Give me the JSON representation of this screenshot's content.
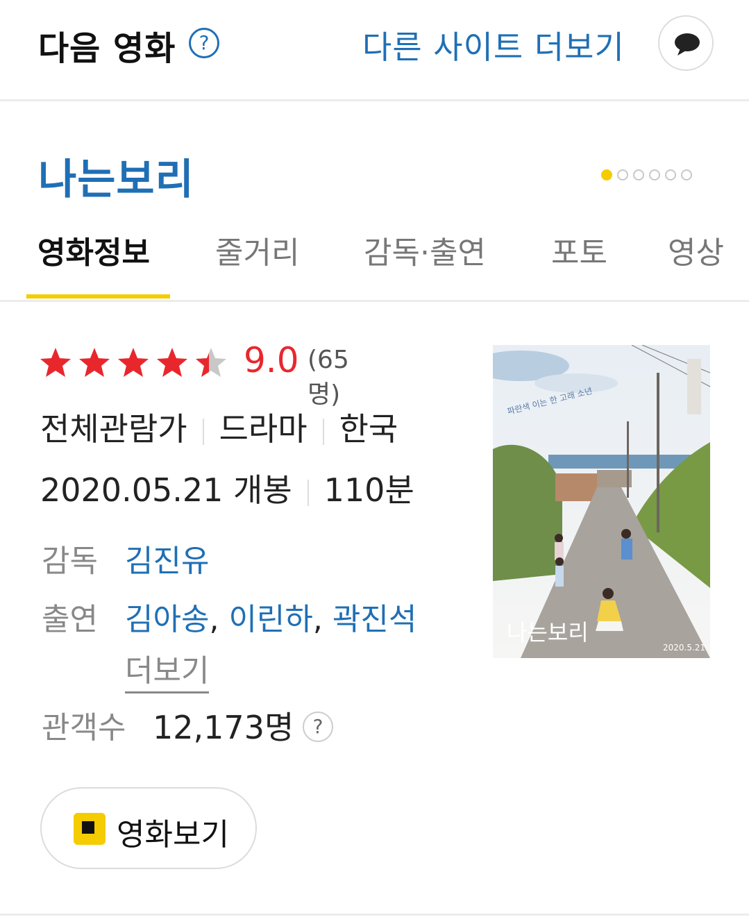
{
  "header": {
    "brand": "다음 영화",
    "help": "?",
    "more_sites": "다른 사이트 더보기"
  },
  "movie": {
    "title": "나는보리",
    "carousel_pages": 6,
    "carousel_active": 1
  },
  "tabs": [
    "영화정보",
    "줄거리",
    "감독·출연",
    "포토",
    "영상"
  ],
  "rating": {
    "stars": 4.5,
    "score": "9.0",
    "voters": "(65명)"
  },
  "meta": {
    "age": "전체관람가",
    "genre": "드라마",
    "country": "한국",
    "release": "2020.05.21 개봉",
    "runtime": "110분"
  },
  "director": {
    "label": "감독",
    "name": "김진유"
  },
  "cast": {
    "label": "출연",
    "names": [
      "김아송",
      "이린하",
      "곽진석"
    ],
    "more": "더보기"
  },
  "audience": {
    "label": "관객수",
    "value": "12,173명",
    "help": "?"
  },
  "poster": {
    "title_text": "나는보리",
    "tagline": "파란색 이는 한 고래 소년",
    "date": "2020.5.21"
  },
  "watch_button": {
    "label": "영화보기"
  },
  "colors": {
    "accent_blue": "#1f6fb5",
    "accent_yellow": "#f5cc00",
    "score_red": "#e8272d"
  }
}
